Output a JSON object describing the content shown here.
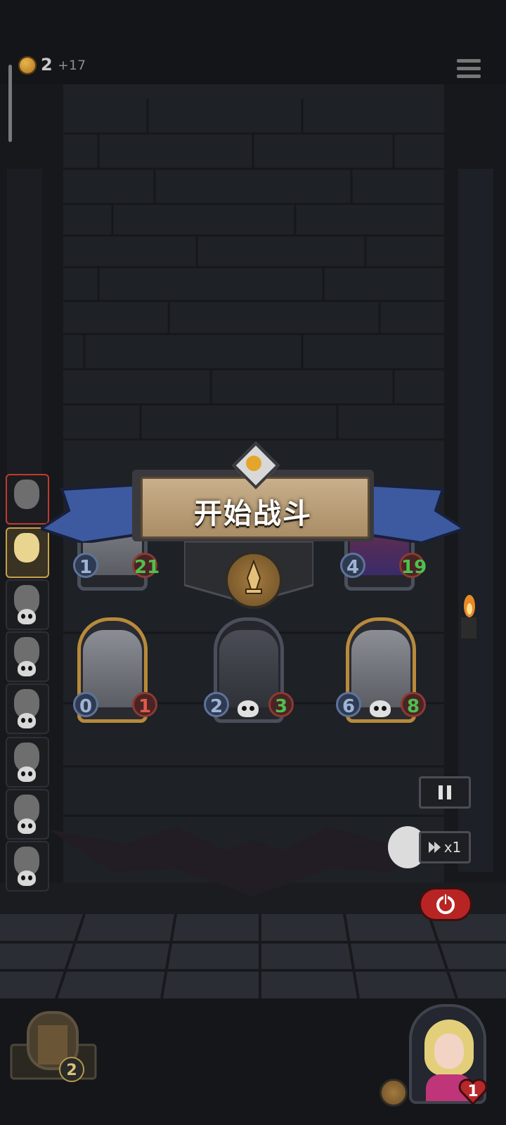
{
  "top_bar": {
    "coins": "2",
    "coin_gain": "+17",
    "coin_icon": "crown-coin-icon",
    "menu_icon": "hamburger-menu-icon"
  },
  "roster": [
    {
      "name": "hero-1",
      "state": "active"
    },
    {
      "name": "hero-2",
      "state": "selected"
    },
    {
      "name": "hero-3",
      "state": "dead"
    },
    {
      "name": "hero-4",
      "state": "dead"
    },
    {
      "name": "hero-5",
      "state": "dead"
    },
    {
      "name": "hero-6",
      "state": "dead"
    },
    {
      "name": "hero-7",
      "state": "dead"
    },
    {
      "name": "hero-8",
      "state": "dead"
    }
  ],
  "banner": {
    "title": "开始战斗"
  },
  "board": {
    "top_row": [
      {
        "attack": "1",
        "health": "21"
      },
      {
        "attack": "4",
        "health": "19"
      }
    ],
    "bottom_row": [
      {
        "attack": "0",
        "health": "1"
      },
      {
        "attack": "2",
        "health": "3"
      },
      {
        "attack": "6",
        "health": "8"
      }
    ]
  },
  "controls": {
    "pause_icon": "pause-icon",
    "speed_label": "x1",
    "power_icon": "power-icon"
  },
  "bottom": {
    "chest_count": "2",
    "hero_health": "1"
  },
  "colors": {
    "gold": "#b88a3b",
    "health_red": "#e05a4a",
    "health_green": "#4fbf4f",
    "attack_blue": "#9fb3d4",
    "ribbon_blue": "#3d5aa0",
    "power_red": "#b82424"
  }
}
